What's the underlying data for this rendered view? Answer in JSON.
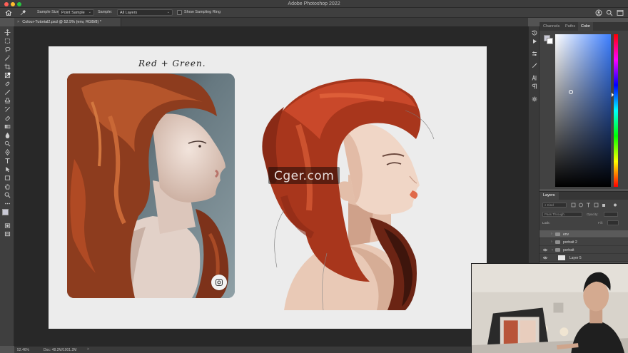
{
  "app": {
    "title": "Adobe Photoshop 2022"
  },
  "options_bar": {
    "sample_size_label": "Sample Size:",
    "sample_size_value": "Point Sample",
    "sample_label": "Sample:",
    "sample_value": "All Layers",
    "sampling_ring_label": "Show Sampling Ring"
  },
  "document_tab": {
    "label": "Colour-Tutorial2.psd @ 52.5% (env, RGB/8) *",
    "close_glyph": "×"
  },
  "canvas": {
    "title": "Red + Green."
  },
  "watermark": {
    "text": "Cger.com"
  },
  "color_panel": {
    "tabs": [
      "Channels",
      "Paths",
      "Color"
    ],
    "active_tab": "Color",
    "foreground_color": "#c9c9d6",
    "background_color": "#ffffff"
  },
  "layers_panel": {
    "tab": "Layers",
    "filter_kind": "Kind",
    "blend_mode": "Pass Through",
    "opacity_label": "Opacity:",
    "lock_label": "Lock:",
    "fill_label": "Fill:",
    "layers": [
      {
        "name": "env",
        "type": "group",
        "visible": false,
        "selected": true
      },
      {
        "name": "portrait 2",
        "type": "group",
        "visible": false,
        "selected": false
      },
      {
        "name": "portrait",
        "type": "group",
        "visible": true,
        "selected": false
      },
      {
        "name": "Layer 5",
        "type": "layer",
        "visible": true,
        "selected": false
      }
    ]
  },
  "status_bar": {
    "zoom": "52.46%",
    "doc_info": "Doc: 48.2M/1001.2M",
    "arrow": ">"
  },
  "colors": {
    "ui_dark": "#3f3f3f",
    "workspace": "#282828",
    "canvas": "#ececec",
    "hair_red": "#a8361c"
  }
}
